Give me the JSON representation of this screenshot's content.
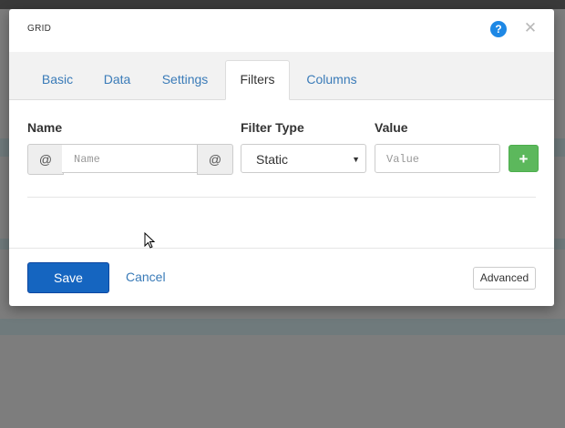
{
  "modal": {
    "title": "GRID",
    "help_icon": "question-circle-icon",
    "close_icon": "close-icon"
  },
  "tabs": [
    {
      "label": "Basic",
      "active": false
    },
    {
      "label": "Data",
      "active": false
    },
    {
      "label": "Settings",
      "active": false
    },
    {
      "label": "Filters",
      "active": true
    },
    {
      "label": "Columns",
      "active": false
    }
  ],
  "filters": {
    "name_label": "Name",
    "filter_type_label": "Filter Type",
    "value_label": "Value",
    "name_prefix": "@",
    "name_suffix": "@",
    "name_placeholder": "Name",
    "filter_type_selected": "Static",
    "value_placeholder": "Value",
    "add_button_icon": "plus-icon"
  },
  "footer": {
    "save_label": "Save",
    "cancel_label": "Cancel",
    "advanced_label": "Advanced"
  },
  "colors": {
    "primary": "#1565c0",
    "success": "#5cb85c",
    "link": "#3a7bb8",
    "help": "#1e88e5"
  }
}
